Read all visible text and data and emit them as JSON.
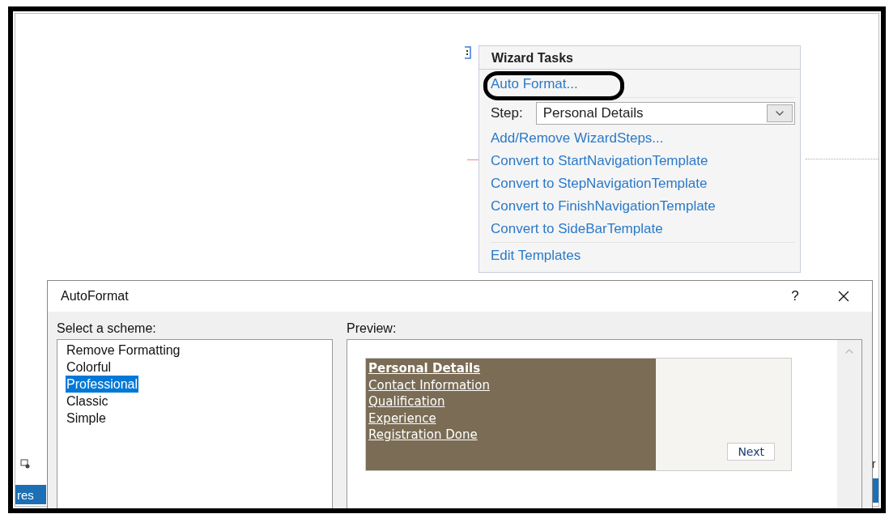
{
  "background": {
    "left_tab": "res",
    "right_tab": "r"
  },
  "tasks_panel": {
    "title": "Wizard Tasks",
    "items": [
      {
        "kind": "link",
        "label": "Auto Format...",
        "circled": true
      },
      {
        "kind": "separator"
      },
      {
        "kind": "select",
        "label": "Step:",
        "value": "Personal Details"
      },
      {
        "kind": "link",
        "label": "Add/Remove WizardSteps...",
        "circled": false
      },
      {
        "kind": "link",
        "label": "Convert to StartNavigationTemplate",
        "circled": false
      },
      {
        "kind": "link",
        "label": "Convert to StepNavigationTemplate",
        "circled": false
      },
      {
        "kind": "link",
        "label": "Convert to FinishNavigationTemplate",
        "circled": false
      },
      {
        "kind": "link",
        "label": "Convert to SideBarTemplate",
        "circled": false
      },
      {
        "kind": "separator"
      },
      {
        "kind": "link",
        "label": "Edit Templates",
        "circled": false
      }
    ]
  },
  "dialog": {
    "title": "AutoFormat",
    "help": "?",
    "scheme_label": "Select a scheme:",
    "schemes": [
      {
        "label": "Remove Formatting",
        "selected": false
      },
      {
        "label": "Colorful",
        "selected": false
      },
      {
        "label": "Professional",
        "selected": true
      },
      {
        "label": "Classic",
        "selected": false
      },
      {
        "label": "Simple",
        "selected": false
      }
    ],
    "preview_label": "Preview:",
    "preview": {
      "steps": [
        {
          "label": "Personal Details",
          "selected": true
        },
        {
          "label": "Contact Information",
          "selected": false
        },
        {
          "label": "Qualification",
          "selected": false
        },
        {
          "label": "Experience",
          "selected": false
        },
        {
          "label": "Registration Done",
          "selected": false
        }
      ],
      "next_button": "Next"
    }
  }
}
